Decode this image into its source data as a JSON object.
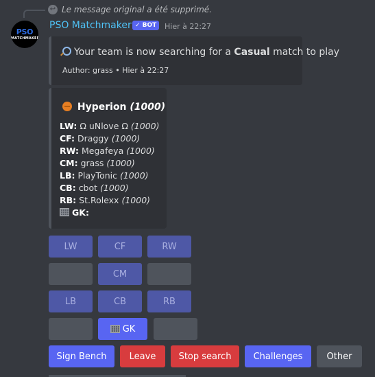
{
  "reply": {
    "text": "Le message original a été supprimé.",
    "icon": "reply-arrow-icon"
  },
  "message": {
    "author": "PSO Matchmaker",
    "bot_badge": "✓ BOT",
    "timestamp": "Hier à 22:27",
    "avatar": {
      "line1_blue": "PSO",
      "line2": "MATCHMAKER"
    }
  },
  "embed1": {
    "title_prefix": "Your team is now searching for a ",
    "title_bold": "Casual",
    "title_suffix": " match to play",
    "footer": "Author: grass • Hier à 22:27"
  },
  "embed2": {
    "team_name": "Hyperion",
    "team_rating": "(1000)",
    "positions": [
      {
        "pos": "LW:",
        "player": "Ω uNlove Ω",
        "rating": "(1000)"
      },
      {
        "pos": "CF:",
        "player": "Draggy",
        "rating": "(1000)"
      },
      {
        "pos": "RW:",
        "player": "Megafeya",
        "rating": "(1000)"
      },
      {
        "pos": "CM:",
        "player": "grass",
        "rating": "(1000)"
      },
      {
        "pos": "LB:",
        "player": "PlayTonic",
        "rating": "(1000)"
      },
      {
        "pos": "CB:",
        "player": "cbot",
        "rating": "(1000)"
      },
      {
        "pos": "RB:",
        "player": "St.Rolexx",
        "rating": "(1000)"
      }
    ],
    "gk_label": "GK:"
  },
  "position_buttons": {
    "lw": "LW",
    "cf": "CF",
    "rw": "RW",
    "cm": "CM",
    "lb": "LB",
    "cb": "CB",
    "rb": "RB",
    "gk": "GK"
  },
  "actions": {
    "sign_bench": "Sign Bench",
    "leave": "Leave",
    "stop_search": "Stop search",
    "challenges": "Challenges",
    "other": "Other"
  },
  "colors": {
    "blurple": "#5865f2",
    "red": "#d83c3e",
    "gray": "#4f545c",
    "background": "#36393f",
    "embed": "#2f3136",
    "author": "#4fc3f7"
  }
}
